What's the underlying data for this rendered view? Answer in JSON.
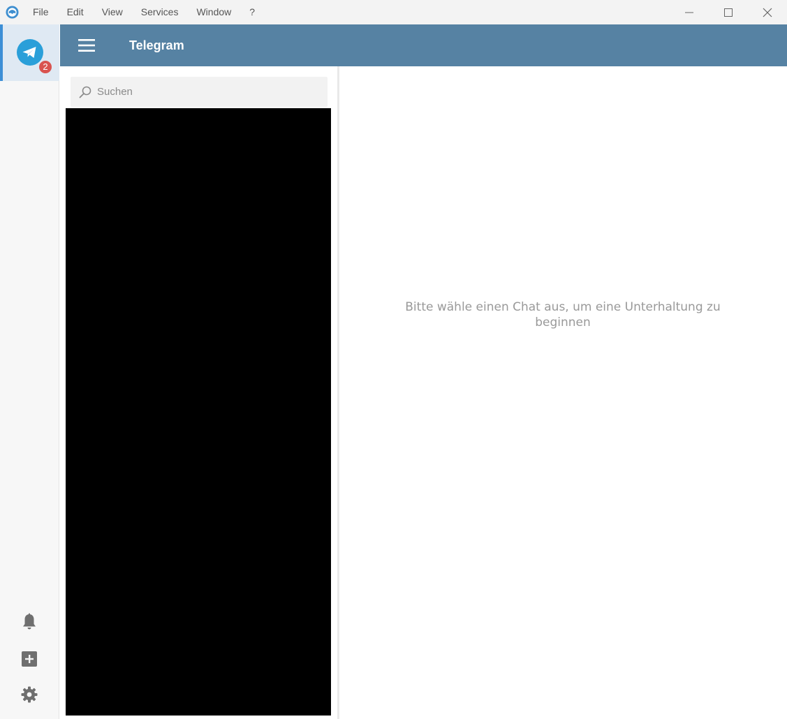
{
  "window": {
    "menu": [
      "File",
      "Edit",
      "View",
      "Services",
      "Window",
      "?"
    ],
    "controls": [
      "minimize-icon",
      "maximize-icon",
      "close-icon"
    ]
  },
  "rail": {
    "service_name": "Telegram",
    "badge_count": "2",
    "badge_color": "#d9534f",
    "active_tab_color": "#dfe9f3",
    "bottom_icons": [
      "bell-icon",
      "add-service-icon",
      "gear-icon"
    ]
  },
  "header": {
    "title": "Telegram",
    "color": "#5682a3"
  },
  "search": {
    "placeholder": "Suchen",
    "value": ""
  },
  "conversation": {
    "empty_message": "Bitte wähle einen Chat aus, um eine Unterhaltung zu beginnen"
  }
}
